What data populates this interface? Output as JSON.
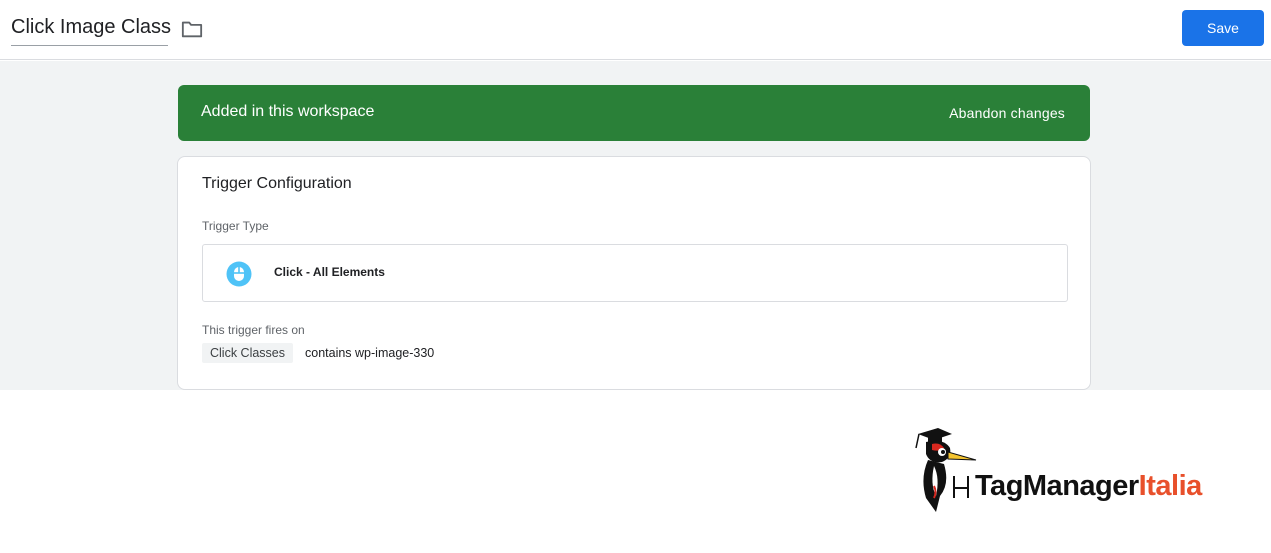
{
  "header": {
    "title": "Click Image Class",
    "save_label": "Save"
  },
  "banner": {
    "text": "Added in this workspace",
    "action_label": "Abandon changes",
    "color": "#2a8038"
  },
  "card": {
    "title": "Trigger Configuration",
    "type_label": "Trigger Type",
    "trigger_type": "Click - All Elements",
    "fires_label": "This trigger fires on",
    "condition_variable": "Click Classes",
    "condition_text": "contains wp-image-330"
  },
  "logo": {
    "part1": "TagManager",
    "part2": "Italia"
  },
  "colors": {
    "primary": "#1a73e8",
    "success": "#2a8038",
    "icon": "#4fc3f7",
    "brand_accent": "#e8502b"
  },
  "icons": [
    "folder-icon",
    "mouse-icon",
    "woodpecker-mascot"
  ]
}
